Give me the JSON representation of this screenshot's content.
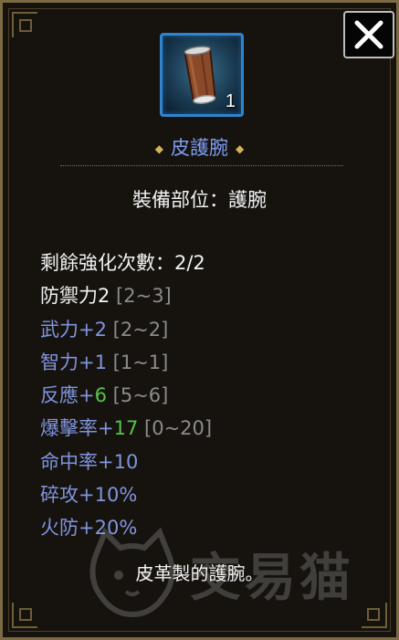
{
  "item": {
    "name": "皮護腕",
    "stack_count": "1",
    "slot_line": "裝備部位：護腕",
    "description": "皮革製的護腕。"
  },
  "stats": [
    {
      "parts": [
        {
          "text": "剩餘強化次數：2/2",
          "color": "white"
        }
      ]
    },
    {
      "parts": [
        {
          "text": "防禦力2",
          "color": "white"
        },
        {
          "text": " [2~3]",
          "color": "gray"
        }
      ]
    },
    {
      "parts": [
        {
          "text": "武力+2",
          "color": "blue"
        },
        {
          "text": " [2~2]",
          "color": "gray"
        }
      ]
    },
    {
      "parts": [
        {
          "text": "智力+1",
          "color": "blue"
        },
        {
          "text": " [1~1]",
          "color": "gray"
        }
      ]
    },
    {
      "parts": [
        {
          "text": "反應+",
          "color": "blue"
        },
        {
          "text": "6",
          "color": "green"
        },
        {
          "text": " [5~6]",
          "color": "gray"
        }
      ]
    },
    {
      "parts": [
        {
          "text": "爆擊率+",
          "color": "blue"
        },
        {
          "text": "17",
          "color": "green"
        },
        {
          "text": " [0~20]",
          "color": "gray"
        }
      ]
    },
    {
      "parts": [
        {
          "text": "命中率+10",
          "color": "blue"
        }
      ]
    },
    {
      "parts": [
        {
          "text": "碎攻+10%",
          "color": "blue"
        }
      ]
    },
    {
      "parts": [
        {
          "text": "火防+20%",
          "color": "blue"
        }
      ]
    }
  ],
  "watermark": {
    "text": "交易猫"
  },
  "icons": {
    "close": "close-x-icon",
    "item": "leather-bracer-icon",
    "ornament": "diamond-ornament-icon"
  },
  "colors": {
    "name": "#7d9cf0",
    "bonus": "#8094dd",
    "enhanced": "#57c44c",
    "range": "#8b8b8b",
    "slot_border": "#2f84d0"
  }
}
